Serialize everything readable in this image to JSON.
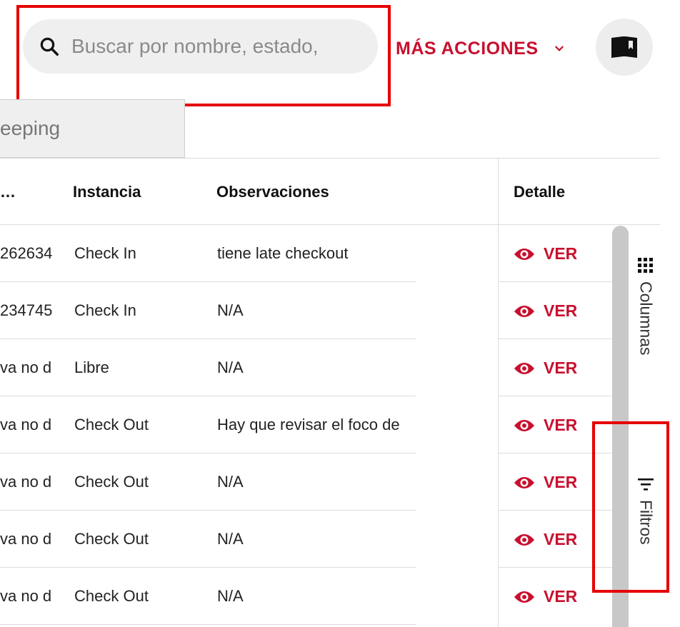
{
  "search": {
    "placeholder": "Buscar por nombre, estado,",
    "icon": "search-icon"
  },
  "header": {
    "more_actions_label": "MÁS ACCIONES",
    "book_icon": "book-icon"
  },
  "tab": {
    "label": "keeping"
  },
  "table": {
    "headers": {
      "col1": "…",
      "instancia": "Instancia",
      "observaciones": "Observaciones",
      "detalle": "Detalle"
    },
    "rows": [
      {
        "col1": "262634",
        "instancia": "Check In",
        "observaciones": "tiene late checkout",
        "detalle": "VER"
      },
      {
        "col1": "234745",
        "instancia": "Check In",
        "observaciones": "N/A",
        "detalle": "VER"
      },
      {
        "col1": "va no d",
        "instancia": "Libre",
        "observaciones": "N/A",
        "detalle": "VER"
      },
      {
        "col1": "va no d",
        "instancia": "Check Out",
        "observaciones": "Hay que revisar el foco de",
        "detalle": "VER"
      },
      {
        "col1": "va no d",
        "instancia": "Check Out",
        "observaciones": "N/A",
        "detalle": "VER"
      },
      {
        "col1": "va no d",
        "instancia": "Check Out",
        "observaciones": "N/A",
        "detalle": "VER"
      },
      {
        "col1": "va no d",
        "instancia": "Check Out",
        "observaciones": "N/A",
        "detalle": "VER"
      }
    ]
  },
  "side_panel": {
    "columns_label": "Columnas",
    "filters_label": "Filtros"
  },
  "colors": {
    "accent": "#c8102e",
    "highlight": "#e60000"
  }
}
